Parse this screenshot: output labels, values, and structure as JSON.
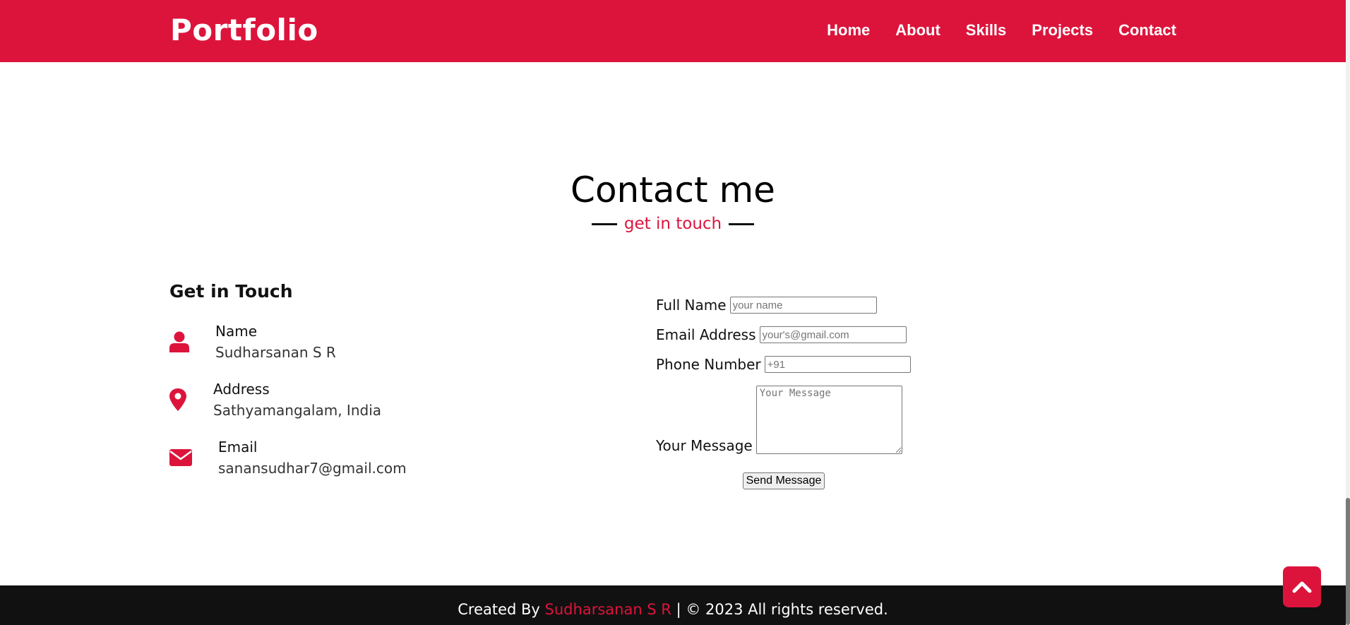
{
  "navbar": {
    "brand": "Portfolio",
    "links": [
      "Home",
      "About",
      "Skills",
      "Projects",
      "Contact"
    ]
  },
  "section": {
    "title": "Contact me",
    "subtitle": "get in touch"
  },
  "info": {
    "heading": "Get in Touch",
    "items": [
      {
        "icon": "user-icon",
        "label": "Name",
        "value": "Sudharsanan S R"
      },
      {
        "icon": "map-marker-icon",
        "label": "Address",
        "value": "Sathyamangalam, India"
      },
      {
        "icon": "envelope-icon",
        "label": "Email",
        "value": "sanansudhar7@gmail.com"
      }
    ]
  },
  "form": {
    "full_name_label": "Full Name",
    "full_name_placeholder": "your name",
    "email_label": "Email Address",
    "email_placeholder": "your's@gmail.com",
    "phone_label": "Phone Number",
    "phone_placeholder": "+91",
    "message_label": "Your Message",
    "message_placeholder": "Your Message",
    "submit_label": "Send Message"
  },
  "footer": {
    "prefix": "Created By",
    "name": "Sudharsanan S R",
    "suffix": "| © 2023 All rights reserved."
  },
  "colors": {
    "accent": "#dc143c",
    "footer_bg": "#111111"
  }
}
